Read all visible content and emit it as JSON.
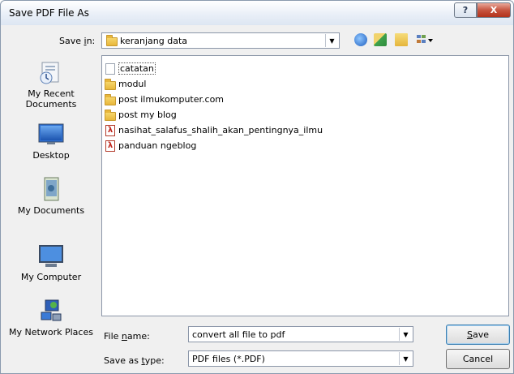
{
  "window": {
    "title": "Save PDF File As",
    "help_glyph": "?",
    "close_glyph": "X"
  },
  "save_in": {
    "label_pre": "Save ",
    "label_u": "i",
    "label_post": "n:",
    "value": "keranjang data"
  },
  "places": [
    {
      "id": "recent",
      "label": "My Recent Documents"
    },
    {
      "id": "desktop",
      "label": "Desktop"
    },
    {
      "id": "documents",
      "label": "My Documents"
    },
    {
      "id": "computer",
      "label": "My Computer"
    },
    {
      "id": "network",
      "label": "My Network Places"
    }
  ],
  "files": [
    {
      "name": "catatan",
      "type": "doc"
    },
    {
      "name": "modul",
      "type": "folder"
    },
    {
      "name": "post ilmukomputer.com",
      "type": "folder"
    },
    {
      "name": "post my blog",
      "type": "folder"
    },
    {
      "name": "nasihat_salafus_shalih_akan_pentingnya_ilmu",
      "type": "pdf"
    },
    {
      "name": "panduan ngeblog",
      "type": "pdf"
    }
  ],
  "file_name": {
    "label_pre": "File ",
    "label_u": "n",
    "label_post": "ame:",
    "value": "convert all file to pdf"
  },
  "save_type": {
    "label_pre": "Save as ",
    "label_u": "t",
    "label_post": "ype:",
    "value": "PDF files (*.PDF)"
  },
  "buttons": {
    "save_u": "S",
    "save_rest": "ave",
    "cancel": "Cancel"
  }
}
